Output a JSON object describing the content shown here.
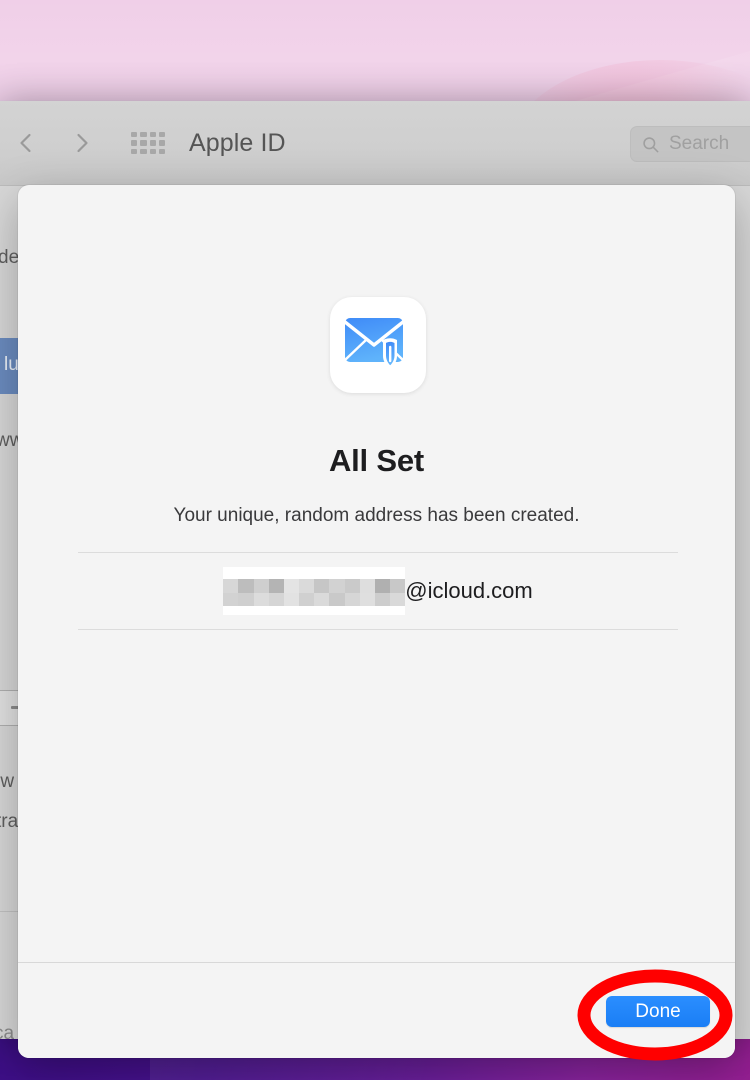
{
  "window": {
    "title": "Apple ID",
    "toolbar": {
      "back_icon": "chevron-left-icon",
      "forward_icon": "chevron-right-icon",
      "grid_icon": "show-all-grid-icon",
      "search_placeholder": "Search",
      "search_value": "",
      "search_icon": "search-icon"
    }
  },
  "background_pane": {
    "fragments": [
      {
        "text": "de"
      },
      {
        "text": "lue"
      },
      {
        "text": "ww"
      },
      {
        "text": "rw"
      },
      {
        "text": "tra"
      },
      {
        "text": "ca"
      }
    ]
  },
  "sheet": {
    "icon_name": "hide-my-email-icon",
    "title": "All Set",
    "subtitle": "Your unique, random address has been created.",
    "email": {
      "local_part_redacted": true,
      "domain": "@icloud.com"
    },
    "footer": {
      "done_label": "Done"
    }
  },
  "annotation": {
    "shape": "ellipse",
    "color": "#FF0000",
    "target": "done-button"
  },
  "colors": {
    "accent_blue": "#1a7ef5",
    "annotation_red": "#FF0000",
    "sheet_background": "#F4F4F4",
    "window_background": "#ECECEC",
    "toolbar_background": "#CFCFCF",
    "selected_row_blue": "#6B8CC0",
    "title_text": "#1D1D1F"
  }
}
